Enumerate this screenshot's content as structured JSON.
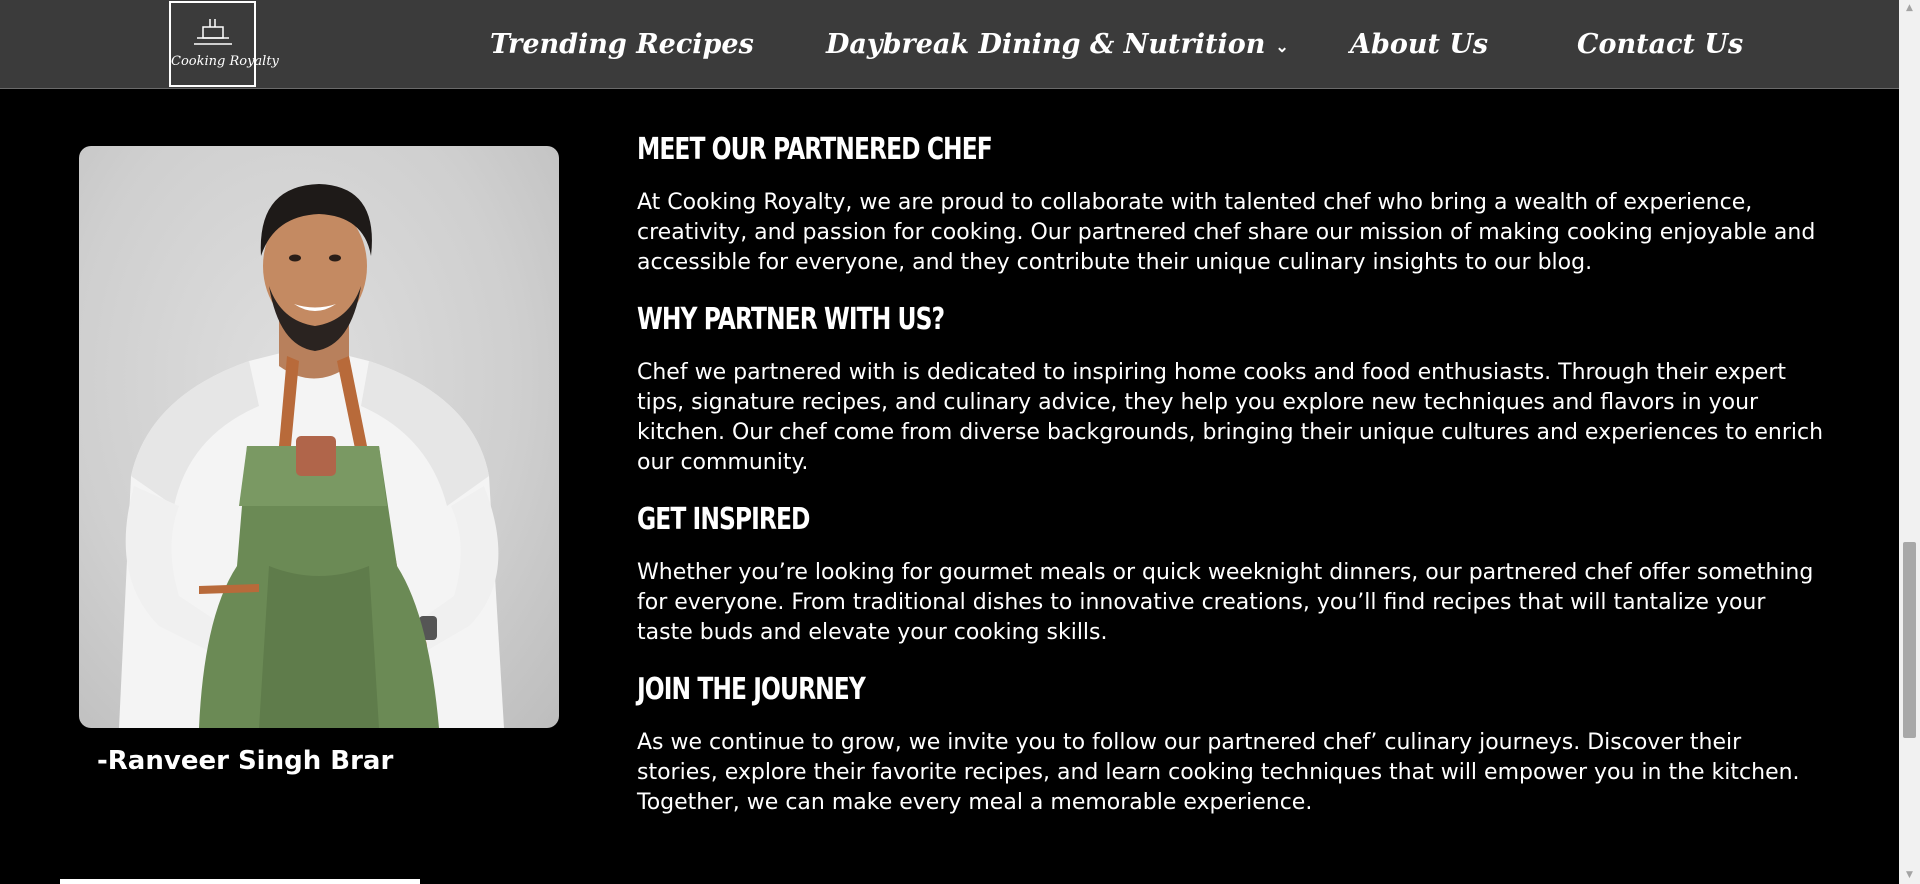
{
  "header": {
    "logo_text": "Cooking Royalty",
    "nav": [
      {
        "label": "Trending Recipes"
      },
      {
        "label": "Daybreak Dining & Nutrition",
        "has_dropdown": true
      },
      {
        "label": "About Us"
      },
      {
        "label": "Contact Us"
      }
    ]
  },
  "chef": {
    "photo_name": "chef-photo",
    "caption": "-Ranveer Singh Brar"
  },
  "sections": [
    {
      "heading": "MEET OUR PARTNERED CHEF",
      "body": "At Cooking Royalty, we are proud to collaborate with talented chef who bring a wealth of experience, creativity, and passion for cooking. Our partnered chef share our mission of making cooking enjoyable and accessible for everyone, and they contribute their unique culinary insights to our blog."
    },
    {
      "heading": "WHY PARTNER WITH US?",
      "body": "Chef we partnered with is dedicated to inspiring home cooks and food enthusiasts. Through their expert tips, signature recipes, and culinary advice, they help you explore new techniques and flavors in your kitchen. Our chef come from diverse backgrounds, bringing their unique cultures and experiences to enrich our community."
    },
    {
      "heading": "GET INSPIRED",
      "body": "Whether you’re looking for gourmet meals or quick weeknight dinners, our partnered chef offer something for everyone. From traditional dishes to innovative creations, you’ll find recipes that will tantalize your taste buds and elevate your cooking skills."
    },
    {
      "heading": "JOIN THE JOURNEY",
      "body": "As we continue to grow, we invite you to follow our partnered chef’ culinary journeys. Discover their stories, explore their favorite recipes, and learn cooking techniques that will empower you in the kitchen. Together, we can make every meal a memorable experience."
    }
  ],
  "colors": {
    "header_bg": "#3b3b3b",
    "page_bg": "#000000",
    "text": "#ffffff",
    "apron": "#6b8a55"
  }
}
